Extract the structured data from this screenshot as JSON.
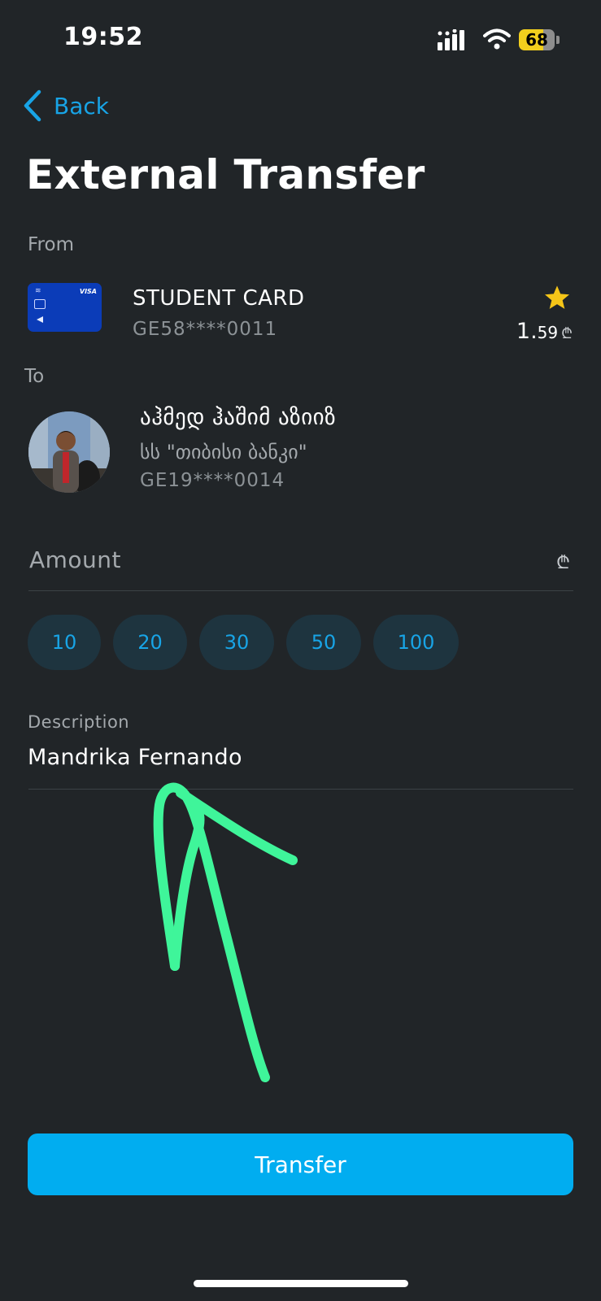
{
  "status_bar": {
    "time": "19:52",
    "battery": "68"
  },
  "nav": {
    "back_label": "Back",
    "title": "External Transfer"
  },
  "from": {
    "label": "From",
    "account_name": "STUDENT CARD",
    "account_number": "GE58****0011",
    "balance_whole": "1.",
    "balance_fraction": "59",
    "currency_symbol": "₾",
    "card_brand": "VISA",
    "favorite": true
  },
  "to": {
    "label": "To",
    "recipient_name": "აჰმედ ჰაშიმ აზიიზ",
    "bank_name": "სს \"თიბისი ბანკი\"",
    "account_number": "GE19****0014"
  },
  "amount": {
    "label": "Amount",
    "currency_symbol": "₾",
    "quick_amounts": [
      "10",
      "20",
      "30",
      "50",
      "100"
    ]
  },
  "description": {
    "label": "Description",
    "value": "Mandrika Fernando"
  },
  "actions": {
    "transfer_label": "Transfer"
  },
  "colors": {
    "background": "#212528",
    "accent": "#01adf0",
    "link": "#18a4e6",
    "chip_bg": "#1e343f",
    "annotation_arrow": "#3ff59a",
    "star": "#f5c518",
    "card_bg": "#0b3cb8"
  }
}
